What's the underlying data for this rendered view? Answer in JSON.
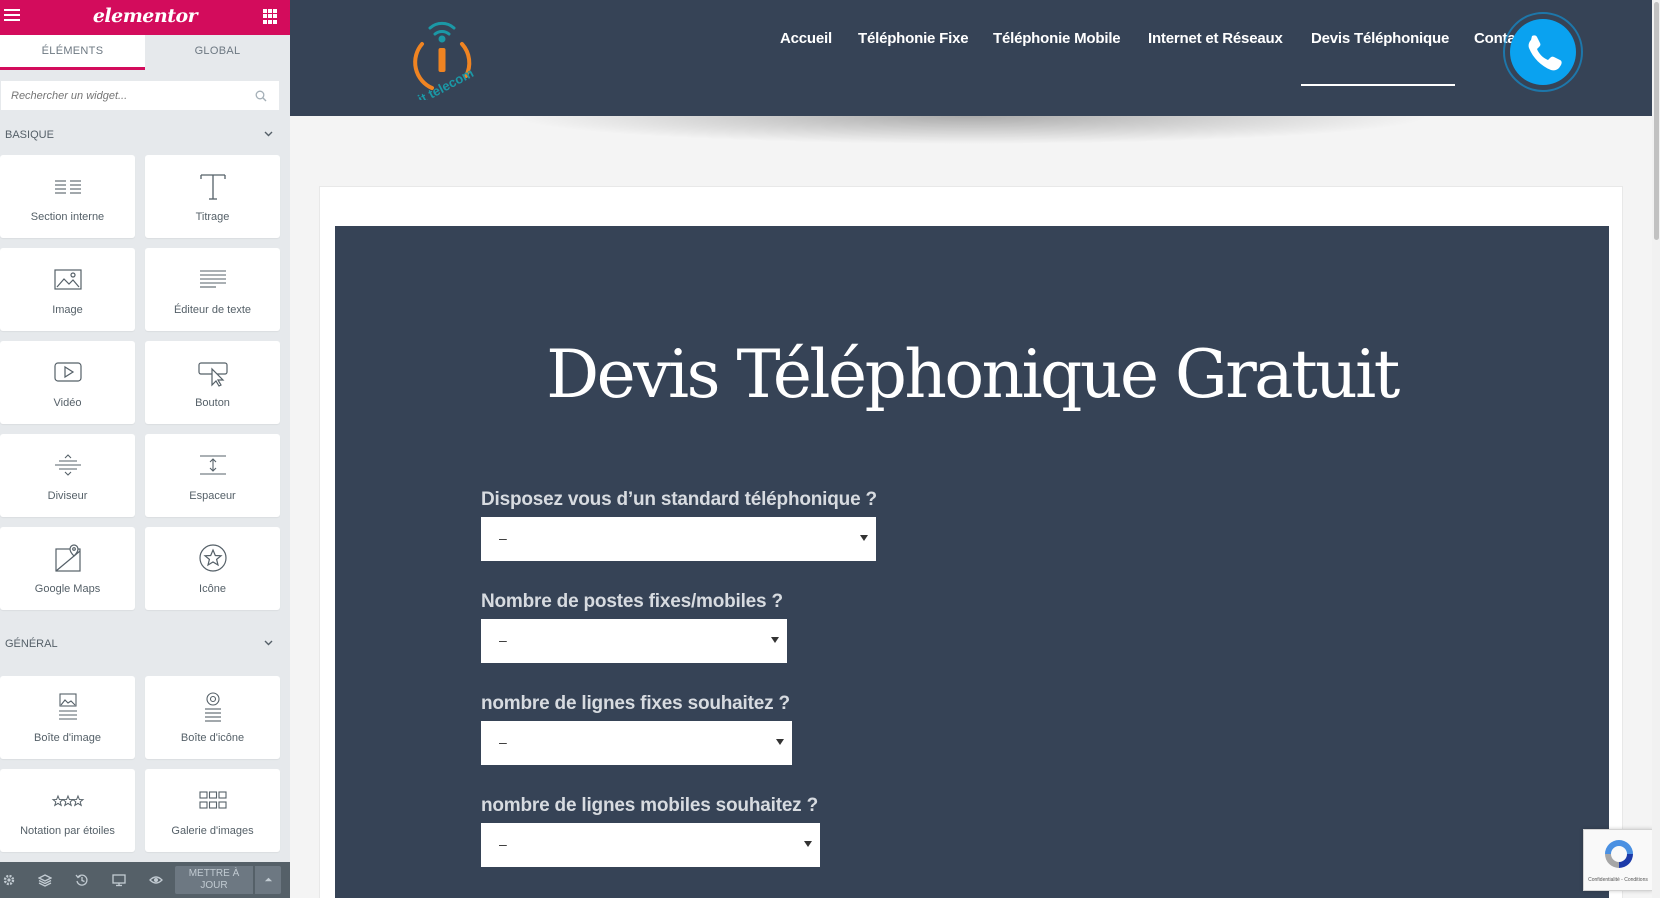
{
  "panel": {
    "brand": "elementor",
    "tabs": [
      "ÉLÉMENTS",
      "GLOBAL"
    ],
    "search_placeholder": "Rechercher un widget...",
    "categories": [
      {
        "title": "BASIQUE",
        "widgets": [
          "Section interne",
          "Titrage",
          "Image",
          "Éditeur de texte",
          "Vidéo",
          "Bouton",
          "Diviseur",
          "Espaceur",
          "Google Maps",
          "Icône"
        ]
      },
      {
        "title": "GÉNÉRAL",
        "widgets": [
          "Boîte d'image",
          "Boîte d'icône",
          "Notation par étoiles",
          "Galerie d'images"
        ]
      }
    ],
    "footer": {
      "update_label": "METTRE À JOUR"
    }
  },
  "site": {
    "logo_text": "it telecom",
    "nav": [
      "Accueil",
      "Téléphonie Fixe",
      "Téléphonie Mobile",
      "Internet et Réseaux",
      "Devis Téléphonique",
      "Conta"
    ],
    "active_nav": "Devis Téléphonique",
    "title": "Devis Téléphonique Gratuit",
    "questions": [
      {
        "label": "Disposez vous d’un standard téléphonique ?",
        "value": "–"
      },
      {
        "label": "Nombre de postes fixes/mobiles ?",
        "value": "–"
      },
      {
        "label": "nombre de lignes fixes souhaitez ?",
        "value": "–"
      },
      {
        "label": "nombre de lignes mobiles souhaitez ?",
        "value": "–"
      }
    ],
    "recaptcha_text": "Confidentialité - Conditions"
  },
  "colors": {
    "brand": "#d30c5c",
    "header": "#364356",
    "call_button": "#0aa2f0"
  }
}
